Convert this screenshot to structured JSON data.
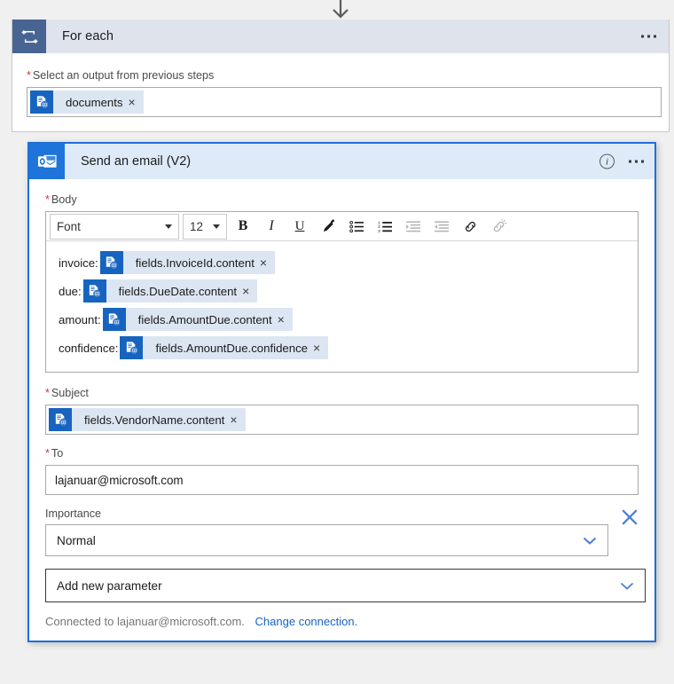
{
  "connector": {
    "icon": "arrow-down-icon"
  },
  "foreach": {
    "icon": "loop-repeat-icon",
    "title": "For each",
    "menu_icon": "ellipsis-icon",
    "input_label": "Select an output from previous steps",
    "required_marker": "*",
    "token": {
      "icon": "form-recognizer-token-icon",
      "text": "documents",
      "remove_icon": "×"
    }
  },
  "email_card": {
    "icon": "outlook-icon",
    "title": "Send an email (V2)",
    "info_icon": "i",
    "info_icon_name": "info-icon",
    "menu_icon": "ellipsis-icon",
    "body": {
      "label": "Body",
      "required_marker": "*",
      "toolbar": {
        "font_select": {
          "value": "Font",
          "caret": "chevron-down-icon"
        },
        "size_select": {
          "value": "12",
          "caret": "chevron-down-icon"
        },
        "buttons": [
          {
            "name": "bold-icon",
            "glyph": "B",
            "disabled": false
          },
          {
            "name": "italic-icon",
            "glyph": "I",
            "disabled": false
          },
          {
            "name": "underline-icon",
            "glyph": "U",
            "disabled": false
          },
          {
            "name": "highlight-pen-icon",
            "glyph": "✐",
            "disabled": false
          },
          {
            "name": "bulleted-list-icon",
            "glyph": "☰",
            "disabled": false
          },
          {
            "name": "numbered-list-icon",
            "glyph": "☰",
            "disabled": false
          },
          {
            "name": "decrease-indent-icon",
            "glyph": "☰",
            "disabled": true
          },
          {
            "name": "increase-indent-icon",
            "glyph": "☰",
            "disabled": true
          },
          {
            "name": "insert-link-icon",
            "glyph": "🔗",
            "disabled": false
          },
          {
            "name": "remove-link-icon",
            "glyph": "🔗",
            "disabled": true
          }
        ]
      },
      "lines": [
        {
          "label": "invoice:",
          "token": "fields.InvoiceId.content",
          "remove_icon": "×",
          "token_icon": "form-recognizer-token-icon"
        },
        {
          "label": "due:",
          "token": "fields.DueDate.content",
          "remove_icon": "×",
          "token_icon": "form-recognizer-token-icon"
        },
        {
          "label": "amount:",
          "token": "fields.AmountDue.content",
          "remove_icon": "×",
          "token_icon": "form-recognizer-token-icon"
        },
        {
          "label": "confidence:",
          "token": "fields.AmountDue.confidence",
          "remove_icon": "×",
          "token_icon": "form-recognizer-token-icon"
        }
      ]
    },
    "subject": {
      "label": "Subject",
      "required_marker": "*",
      "token": {
        "icon": "form-recognizer-token-icon",
        "text": "fields.VendorName.content",
        "remove_icon": "×"
      }
    },
    "to": {
      "label": "To",
      "required_marker": "*",
      "value": "lajanuar@microsoft.com"
    },
    "importance": {
      "label": "Importance",
      "value": "Normal",
      "caret": "chevron-down-icon",
      "clear_icon": "close-x-icon"
    },
    "add_parameter": {
      "label": "Add new parameter",
      "caret": "chevron-down-icon"
    },
    "connection": {
      "text": "Connected to lajanuar@microsoft.com.",
      "link": "Change connection."
    }
  },
  "colors": {
    "foreach_header_bg": "#dfe3ec",
    "foreach_icon_bg": "#486492",
    "email_header_bg": "#deeaf8",
    "email_icon_bg": "#1e74d9",
    "card_border_blue": "#1e6fd9",
    "token_bg": "#dce6f2",
    "token_icon_bg": "#1664c0",
    "link_blue": "#1664c0",
    "required_red": "#d13438",
    "page_bg": "#f0f0f0"
  }
}
